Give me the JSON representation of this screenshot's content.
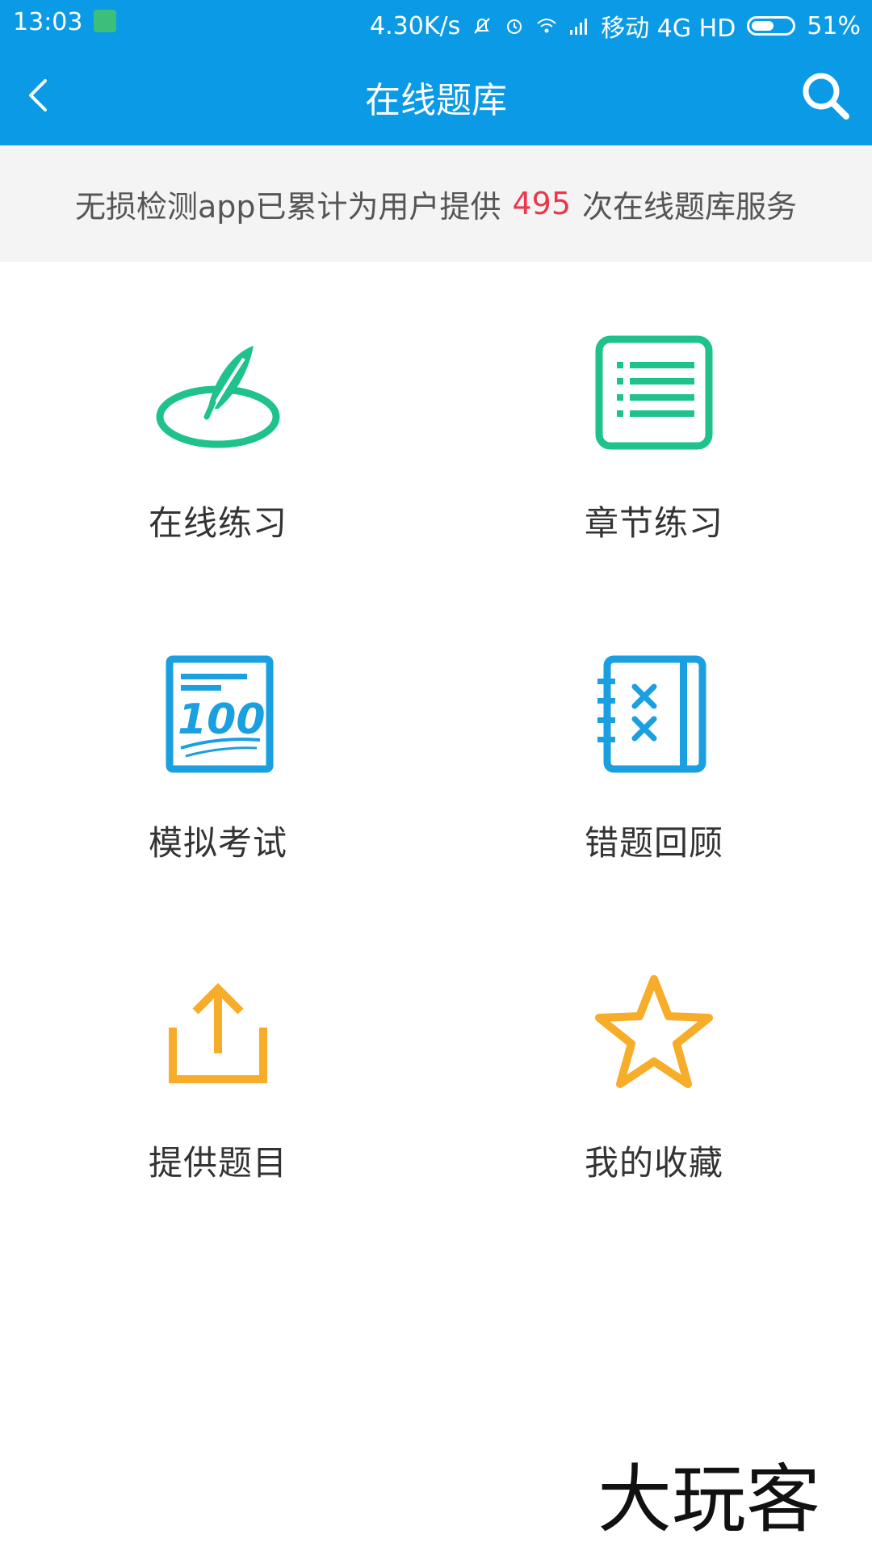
{
  "status_bar": {
    "time": "13:03",
    "network_speed": "4.30K/s",
    "carrier": "移动 4G HD",
    "battery": "51%"
  },
  "app_bar": {
    "title": "在线题库"
  },
  "banner": {
    "prefix": "无损检测app已累计为用户提供",
    "count": "495",
    "suffix": "次在线题库服务"
  },
  "grid": [
    {
      "label": "在线练习",
      "icon": "feather-circle-icon",
      "color": "#1fc28b"
    },
    {
      "label": "章节练习",
      "icon": "list-document-icon",
      "color": "#1fc28b"
    },
    {
      "label": "模拟考试",
      "icon": "exam-100-icon",
      "color": "#1a9fe0"
    },
    {
      "label": "错题回顾",
      "icon": "wrong-notebook-icon",
      "color": "#1a9fe0"
    },
    {
      "label": "提供题目",
      "icon": "upload-icon",
      "color": "#f7ad2a"
    },
    {
      "label": "我的收藏",
      "icon": "star-icon",
      "color": "#f7ad2a"
    }
  ],
  "watermark": {
    "text": "大玩客"
  },
  "colors": {
    "app_bar": "#0a9ae6",
    "highlight": "#e8384b"
  }
}
